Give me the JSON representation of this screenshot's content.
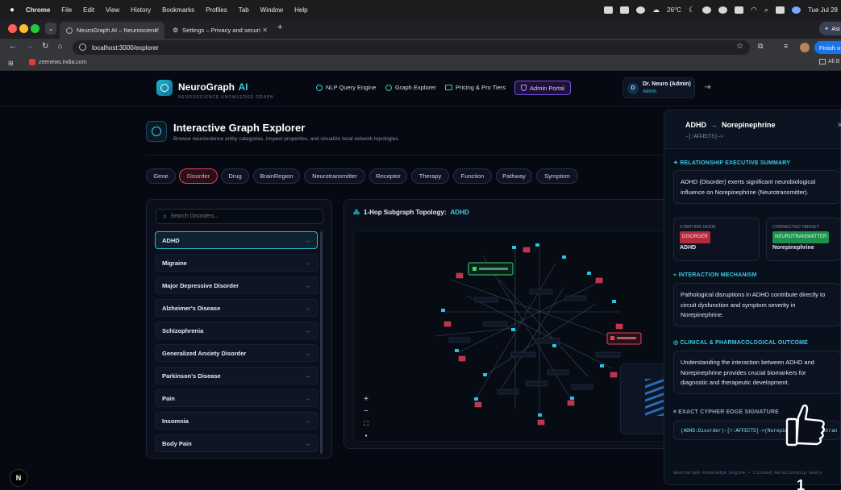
{
  "menubar": {
    "app": "Chrome",
    "items": [
      "File",
      "Edit",
      "View",
      "History",
      "Bookmarks",
      "Profiles",
      "Tab",
      "Window",
      "Help"
    ],
    "weather": "26°C",
    "datetime": "Tue Jul 28"
  },
  "browser": {
    "tabs": [
      {
        "title": "NeuroGraph AI – Neuroscienc"
      },
      {
        "title": "Settings – Privacy and securi"
      }
    ],
    "new_tab": "+",
    "url": "localhost:3000/explorer",
    "finish_update": "Finish u",
    "assistant": "Asi",
    "bookmarks": [
      {
        "label": "zeenews.india.com"
      }
    ],
    "all_bookmarks": "All B"
  },
  "app": {
    "brand": {
      "name": "NeuroGraph",
      "name_accent": "AI",
      "tagline": "NEUROSCIENCE KNOWLEDGE GRAPH"
    },
    "nav": [
      {
        "label": "NLP Query Engine"
      },
      {
        "label": "Graph Explorer"
      },
      {
        "label": "Pricing & Pro Tiers"
      },
      {
        "label": "Admin Portal"
      }
    ],
    "user": {
      "initial": "D",
      "name": "Dr. Neuro (Admin)",
      "role": "Admin"
    },
    "page": {
      "title": "Interactive Graph Explorer",
      "subtitle": "Browse neuroscience entity categories, inspect properties, and visualize local network topologies."
    },
    "categories": [
      "Gene",
      "Disorder",
      "Drug",
      "BrainRegion",
      "Neurotransmitter",
      "Receptor",
      "Therapy",
      "Function",
      "Pathway",
      "Symptom"
    ],
    "active_category": "Disorder",
    "search": {
      "placeholder": "Search Disorders..."
    },
    "entities": [
      "ADHD",
      "Migraine",
      "Major Depressive Disorder",
      "Alzheimer's Disease",
      "Schizophrenia",
      "Generalized Anxiety Disorder",
      "Parkinson's Disease",
      "Pain",
      "Insomnia",
      "Body Pain"
    ],
    "graph": {
      "title": "1-Hop Subgraph Topology:",
      "focus": "ADHD"
    },
    "detail": {
      "source": "ADHD",
      "target": "Norepinephrine",
      "relation": "–[:AFFECTS]–>",
      "summary_title": "RELATIONSHIP EXECUTIVE SUMMARY",
      "summary_text": "ADHD (Disorder) exerts significant neurobiological influence on Norepinephrine (Neurotransmitter).",
      "start_label": "STARTING NODE",
      "start_badge": "DISORDER",
      "start_name": "ADHD",
      "target_label": "CONNECTED TARGET",
      "target_badge": "NEUROTRANSMITTER",
      "target_name": "Norepinephrine",
      "mechanism_title": "INTERACTION MECHANISM",
      "mechanism_text": "Pathological disruptions in ADHD contribute directly to circuit dysfunction and symptom severity in Norepinephrine.",
      "outcome_title": "CLINICAL & PHARMACOLOGICAL OUTCOME",
      "outcome_text": "Understanding the interaction between ADHD and Norepinephrine provides crucial biomarkers for diagnostic and therapeutic development.",
      "cypher_title": "EXACT CYPHER EDGE SIGNATURE",
      "cypher_text": "(ADHD:Disorder)–[r:AFFECTS]–>(Norepinephrine:Neurotran",
      "footer": "NeuroGraph Knowledge Engine • Clicked Relationship Analy"
    },
    "next_badge": "N",
    "overlay_number": "1"
  },
  "colors": {
    "accent": "#35d0e6",
    "danger": "#e0455a",
    "success": "#37d67a",
    "admin": "#9b6cff"
  }
}
